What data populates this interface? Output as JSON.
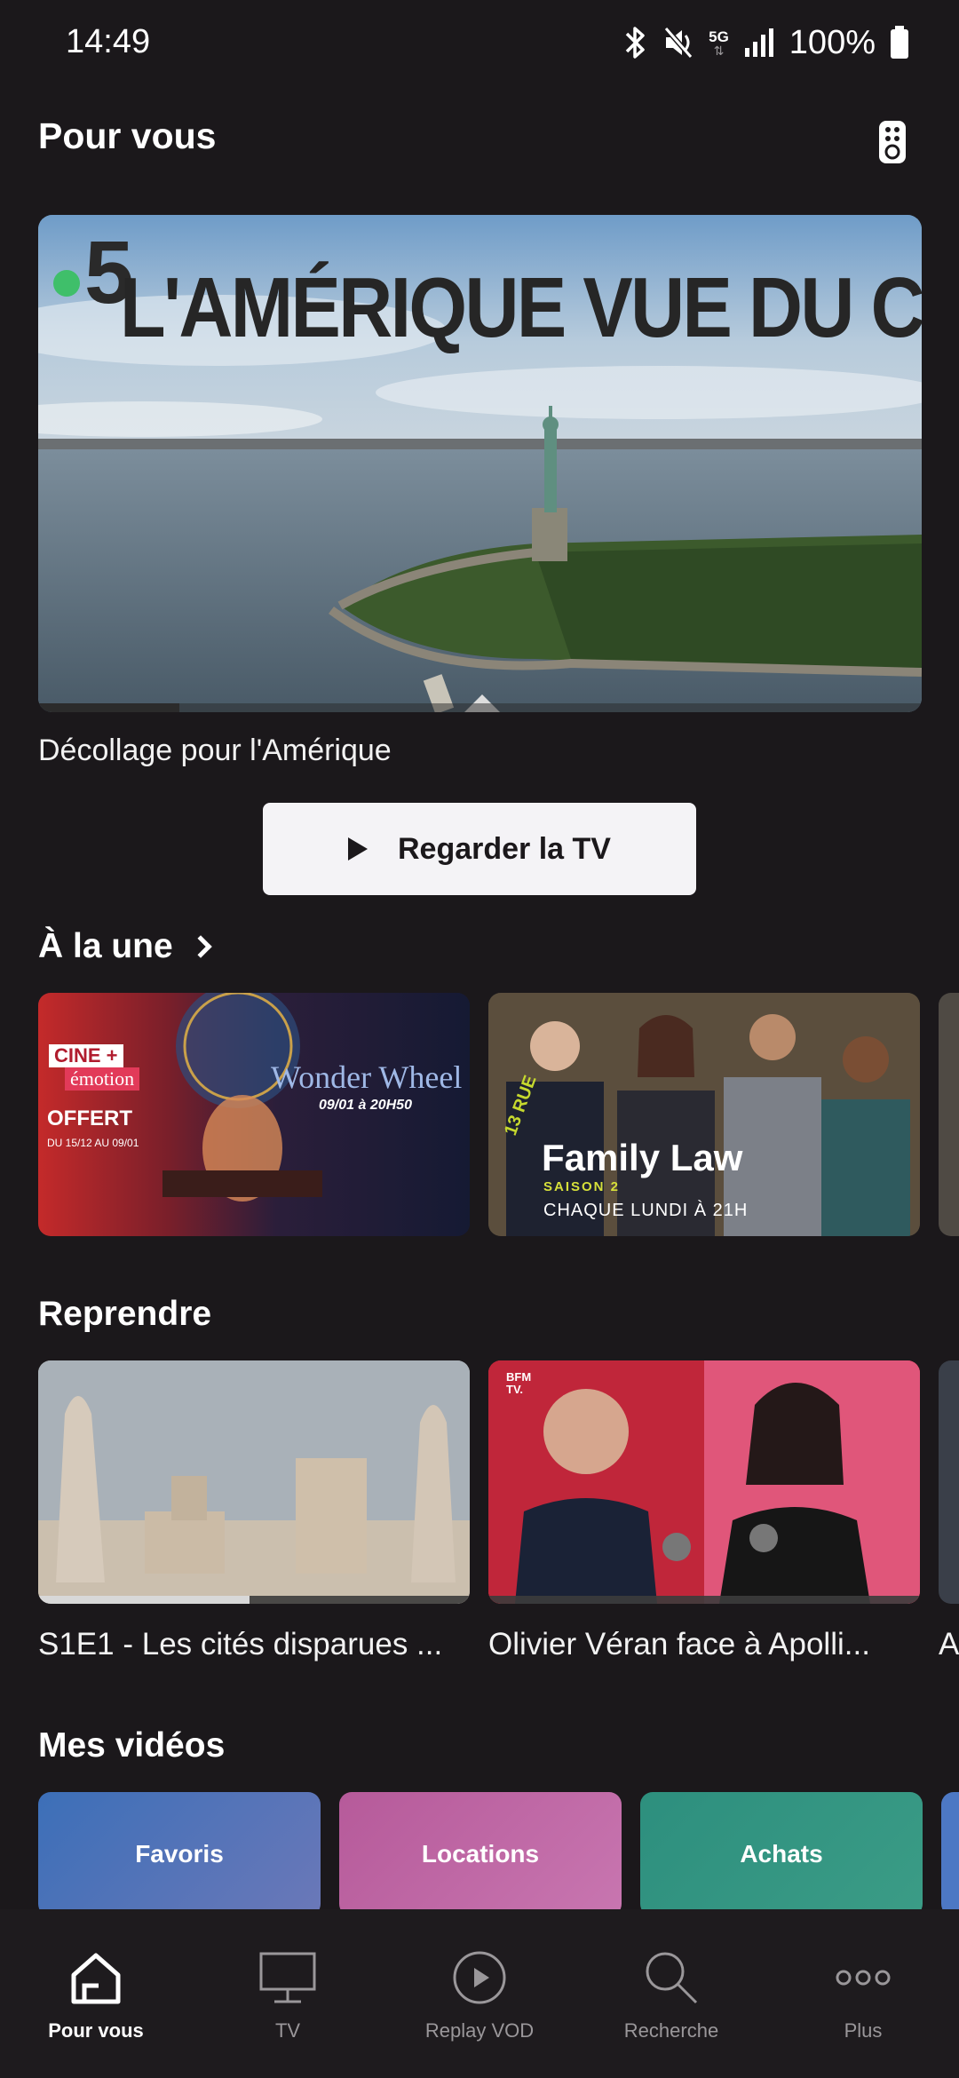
{
  "status_bar": {
    "time": "14:49",
    "network": "5G",
    "battery": "100%",
    "icons": [
      "bluetooth-icon",
      "mute-icon",
      "5g-icon",
      "signal-icon",
      "battery-icon"
    ]
  },
  "header": {
    "title": "Pour vous",
    "remote_icon": "remote-control-icon"
  },
  "hero": {
    "channel": "5",
    "show_title": "L'AMÉRIQUE VUE DU CIEL",
    "program_title": "Décollage pour l'Amérique",
    "progress": 0.16,
    "button_label": "Regarder la TV"
  },
  "a_la_une": {
    "title": "À la une",
    "cards": [
      {
        "channel_line1": "CINE +",
        "channel_line2": "émotion",
        "badge": "OFFERT",
        "dates": "DU 15/12 AU 09/01",
        "movie": "Wonder Wheel",
        "schedule": "09/01 à 20H50"
      },
      {
        "channel": "13 RUE",
        "show": "Family Law",
        "season": "SAISON 2",
        "schedule": "CHAQUE LUNDI À 21H"
      }
    ]
  },
  "reprendre": {
    "title": "Reprendre",
    "items": [
      {
        "caption": "S1E1 - Les cités disparues ...",
        "progress": 0.49
      },
      {
        "caption": "Olivier Véran face à Apolli...",
        "logo": "BFM TV.",
        "progress": 0.0
      },
      {
        "caption": "A"
      }
    ]
  },
  "mes_videos": {
    "title": "Mes vidéos",
    "items": [
      "Favoris",
      "Locations",
      "Achats"
    ]
  },
  "bottom_nav": {
    "items": [
      {
        "label": "Pour vous",
        "icon": "home-icon",
        "active": true
      },
      {
        "label": "TV",
        "icon": "tv-icon",
        "active": false
      },
      {
        "label": "Replay VOD",
        "icon": "play-circle-icon",
        "active": false
      },
      {
        "label": "Recherche",
        "icon": "search-icon",
        "active": false
      },
      {
        "label": "Plus",
        "icon": "more-icon",
        "active": false
      }
    ]
  },
  "colors": {
    "background": "#1b181b",
    "button_bg": "#f4f3f6",
    "accent_green": "#3fbf6a"
  }
}
